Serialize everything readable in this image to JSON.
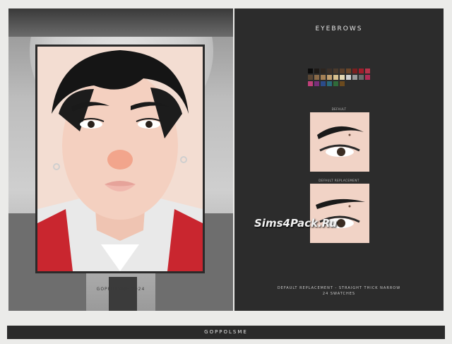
{
  "portrait": {
    "credit": "GOPPOLSME 2024"
  },
  "panel": {
    "title": "EYEBROWS",
    "swatches": [
      "#0b0b0b",
      "#1e1a17",
      "#2e2620",
      "#3d3129",
      "#4a3a2c",
      "#5a3f2b",
      "#6b4629",
      "#7a1f1f",
      "#a11d2b",
      "#b5334a",
      "#5a4634",
      "#8a6a48",
      "#a58055",
      "#c3a070",
      "#d8c08f",
      "#e4d7b3",
      "#cfcfcf",
      "#9a9a9a",
      "#6a6a6a",
      "#b12c56",
      "#c0407a",
      "#7a2f7a",
      "#2b4b8a",
      "#2a6a7a",
      "#2f6b3a",
      "#6b4a1e"
    ],
    "variants": [
      {
        "label": "DEFAULT"
      },
      {
        "label": "DEFAULT REPLACEMENT"
      }
    ],
    "description_line1": "DEFAULT REPLACEMENT - STRAIGHT THICK NARROW",
    "description_line2": "24 SWATCHES"
  },
  "watermark": "Sims4Pack.Ru",
  "footer": {
    "label": "GOPPOLSME"
  }
}
